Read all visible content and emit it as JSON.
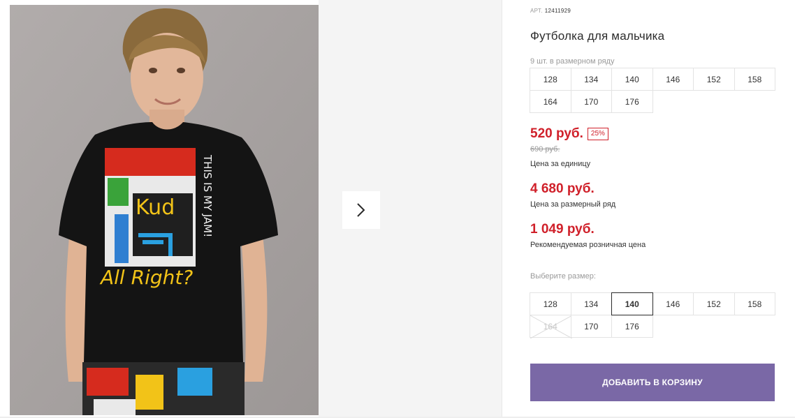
{
  "product": {
    "sku_label": "АРТ.",
    "sku": "12411929",
    "title": "Футболка для мальчика",
    "range_note": "9 шт. в размерном ряду",
    "range_sizes": [
      "128",
      "134",
      "140",
      "146",
      "152",
      "158",
      "164",
      "170",
      "176"
    ],
    "image_alt": "product-photo",
    "shirt_text": "THIS IS MY JAM!"
  },
  "prices": {
    "unit_price": "520 руб.",
    "discount": "25%",
    "old_price": "690 руб.",
    "unit_label": "Цена за единицу",
    "range_price": "4 680 руб.",
    "range_label": "Цена за размерный ряд",
    "retail_price": "1 049 руб.",
    "retail_label": "Рекомендуемая розничная цена"
  },
  "size_selector": {
    "label": "Выберите размер:",
    "sizes": [
      "128",
      "134",
      "140",
      "146",
      "152",
      "158",
      "164",
      "170",
      "176"
    ],
    "selected": "140",
    "unavailable": [
      "164"
    ]
  },
  "cart": {
    "button_label": "ДОБАВИТЬ В КОРЗИНУ"
  },
  "gallery": {
    "next_icon": "chevron-right-icon"
  },
  "colors": {
    "accent": "#7a68a6",
    "price_red": "#d0202a"
  }
}
